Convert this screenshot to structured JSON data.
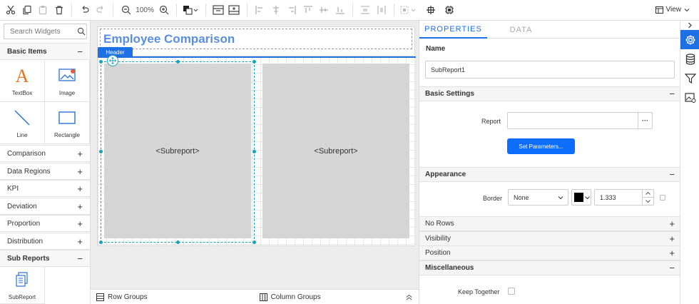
{
  "toolbar": {
    "zoom": "100%",
    "view_label": "View"
  },
  "widgets": {
    "search_placeholder": "Search Widgets",
    "basic_items_label": "Basic Items",
    "items": [
      {
        "label": "TextBox"
      },
      {
        "label": "Image"
      },
      {
        "label": "Line"
      },
      {
        "label": "Rectangle"
      }
    ],
    "categories": [
      "Comparison",
      "Data Regions",
      "KPI",
      "Deviation",
      "Proportion",
      "Distribution"
    ],
    "sub_reports_label": "Sub Reports",
    "subreport_item": "SubReport",
    "plus": "+",
    "minus": "−"
  },
  "design": {
    "title": "Employee Comparison",
    "header_tag": "Header",
    "subreport1": "<Subreport>",
    "subreport2": "<Subreport>"
  },
  "bottom": {
    "row_groups": "Row Groups",
    "column_groups": "Column Groups"
  },
  "properties": {
    "tab_properties": "PROPERTIES",
    "tab_data": "DATA",
    "name_label": "Name",
    "name_value": "SubReport1",
    "basic_settings": "Basic Settings",
    "report_label": "Report",
    "report_value": "",
    "ellipsis": "···",
    "set_parameters": "Set Parameters...",
    "appearance": "Appearance",
    "border_label": "Border",
    "border_style": "None",
    "border_color": "#000000",
    "border_width": "1.333",
    "no_rows": "No Rows",
    "visibility": "Visibility",
    "position": "Position",
    "miscellaneous": "Miscellaneous",
    "keep_together": "Keep Together"
  },
  "colors": {
    "accent": "#1f6fe5",
    "title": "#5a8ee0",
    "selection": "#1aa3b7"
  }
}
